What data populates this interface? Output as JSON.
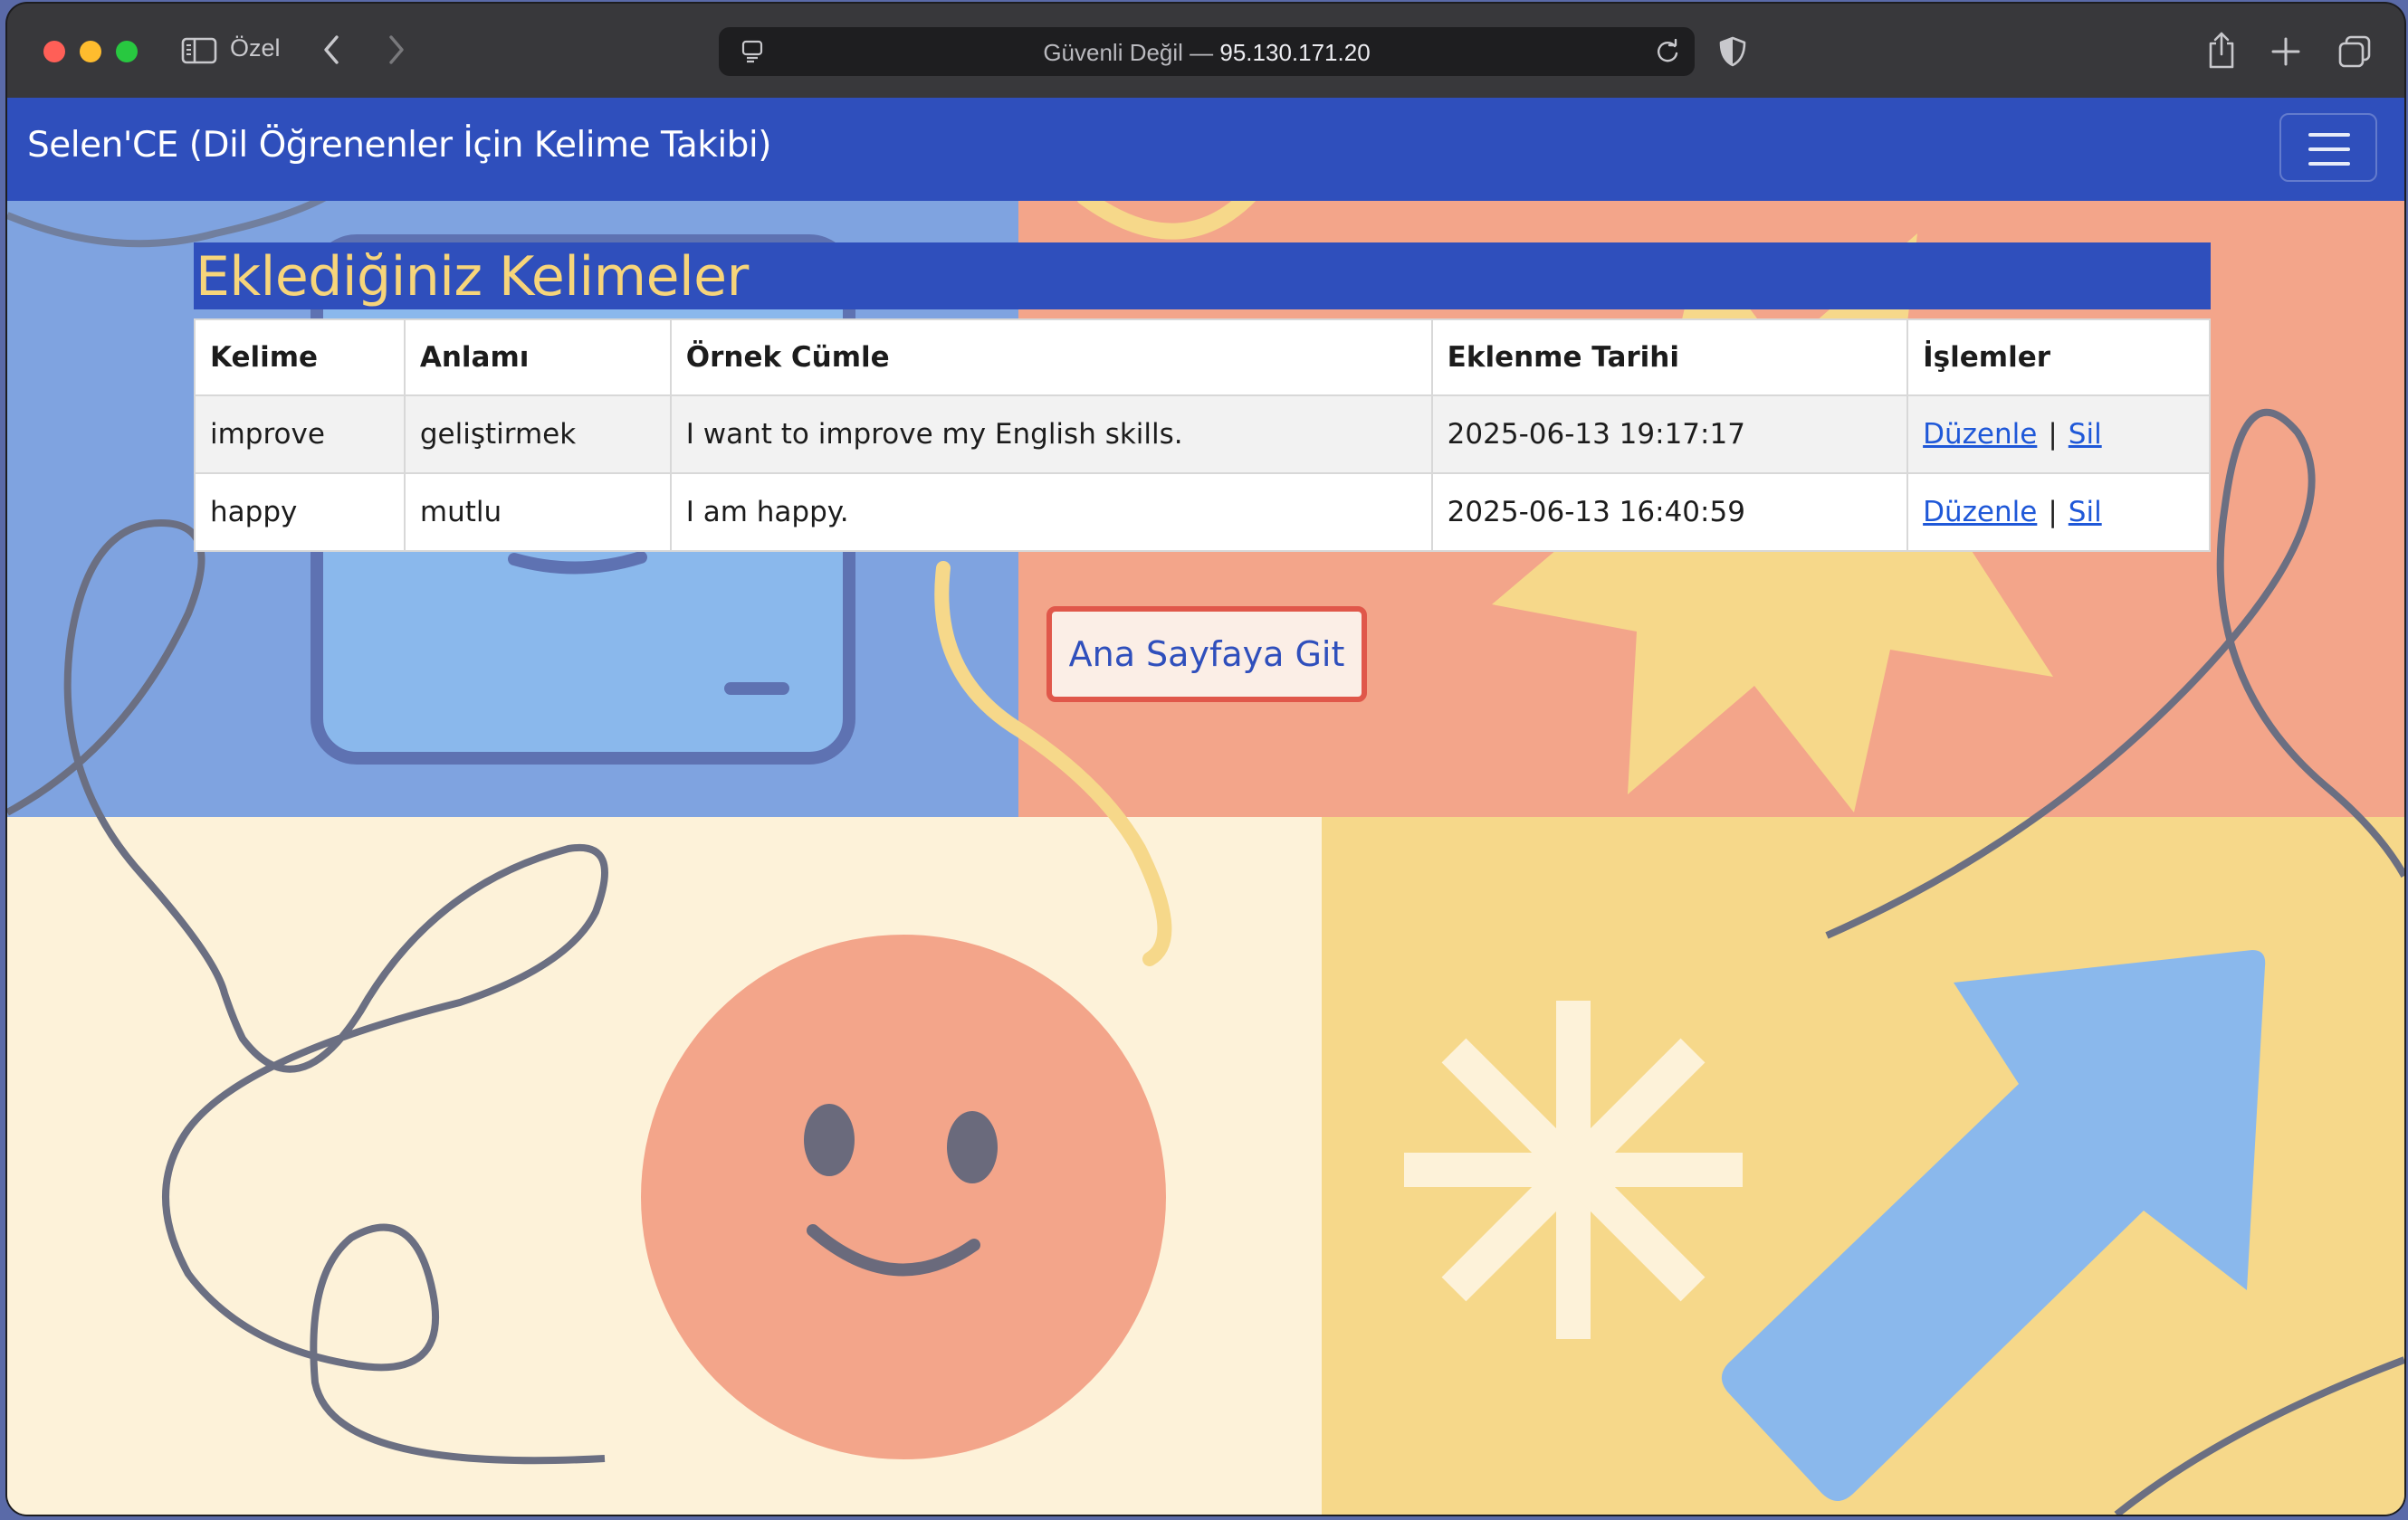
{
  "browser": {
    "private_label": "Özel",
    "address": {
      "prefix": "Güvenli Değil — ",
      "host": "95.130.171.20"
    }
  },
  "navbar": {
    "brand": "Selen'CE (Dil Öğrenenler İçin Kelime Takibi)"
  },
  "main": {
    "heading": "Eklediğiniz Kelimeler",
    "table": {
      "columns": [
        "Kelime",
        "Anlamı",
        "Örnek Cümle",
        "Eklenme Tarihi",
        "İşlemler"
      ],
      "rows": [
        {
          "word": "improve",
          "meaning": "geliştirmek",
          "example": "I want to improve my English skills.",
          "date": "2025-06-13 19:17:17",
          "edit": "Düzenle",
          "delete": "Sil"
        },
        {
          "word": "happy",
          "meaning": "mutlu",
          "example": "I am happy.",
          "date": "2025-06-13 16:40:59",
          "edit": "Düzenle",
          "delete": "Sil"
        }
      ],
      "action_separator": "|"
    },
    "home_button": "Ana Sayfaya Git"
  },
  "colors": {
    "navbar": "#2f4fbc",
    "heading_text": "#f7d57a",
    "link": "#1f58d8",
    "button_border": "#e0574a",
    "bg_blue": "#7fa3e0",
    "bg_salmon": "#f3a58a",
    "bg_cream": "#fdf2d9",
    "bg_yellow": "#f6d88a"
  }
}
